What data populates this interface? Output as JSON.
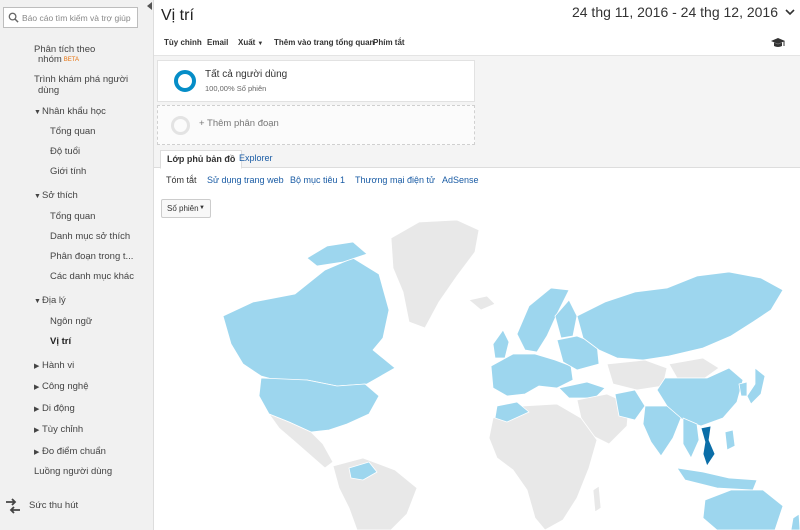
{
  "search": {
    "placeholder": "Báo cáo tìm kiếm và trợ giúp"
  },
  "sidebar": {
    "items": [
      {
        "label": "Phân tích theo"
      },
      {
        "label": "nhóm"
      },
      {
        "label": "Trình khám phá người"
      },
      {
        "label": "dùng"
      },
      {
        "label": "Nhân khẩu học"
      },
      {
        "label": "Tổng quan"
      },
      {
        "label": "Độ tuổi"
      },
      {
        "label": "Giới tính"
      },
      {
        "label": "Sở thích"
      },
      {
        "label": "Tổng quan"
      },
      {
        "label": "Danh mục sở thích"
      },
      {
        "label": "Phân đoạn trong t..."
      },
      {
        "label": "Các danh mục khác"
      },
      {
        "label": "Địa lý"
      },
      {
        "label": "Ngôn ngữ"
      },
      {
        "label": "Vị trí"
      },
      {
        "label": "Hành vi"
      },
      {
        "label": "Công nghệ"
      },
      {
        "label": "Di động"
      },
      {
        "label": "Tùy chỉnh"
      },
      {
        "label": "Đo điểm chuẩn"
      },
      {
        "label": "Luồng người dùng"
      }
    ],
    "beta_badge": "BETA",
    "acquisition_label": "Sức thu hút"
  },
  "header": {
    "title": "Vị trí",
    "date_range": "24 thg 11, 2016 - 24 thg 12, 2016"
  },
  "toolbar": {
    "customize": "Tùy chỉnh",
    "email": "Email",
    "export": "Xuất",
    "add_dashboard": "Thêm vào trang tổng quan",
    "shortcut": "Phím tắt"
  },
  "segments": {
    "all_users": "Tất cả người dùng",
    "all_users_sub": "100,00% Số phiên",
    "add_segment": "+ Thêm phân đoạn"
  },
  "view_tabs": [
    {
      "label": "Lớp phủ bản đồ"
    },
    {
      "label": "Explorer"
    }
  ],
  "sub_tabs": [
    {
      "label": "Tóm tắt"
    },
    {
      "label": "Sử dụng trang web"
    },
    {
      "label": "Bộ mục tiêu 1"
    },
    {
      "label": "Thương mại điện tử"
    },
    {
      "label": "AdSense"
    }
  ],
  "metric_select": {
    "value": "Số phiên"
  },
  "colors": {
    "accent": "#058dc7",
    "map_low": "#9dd6ee",
    "map_high": "#0b6ea8",
    "map_none": "#e8e8e8"
  }
}
